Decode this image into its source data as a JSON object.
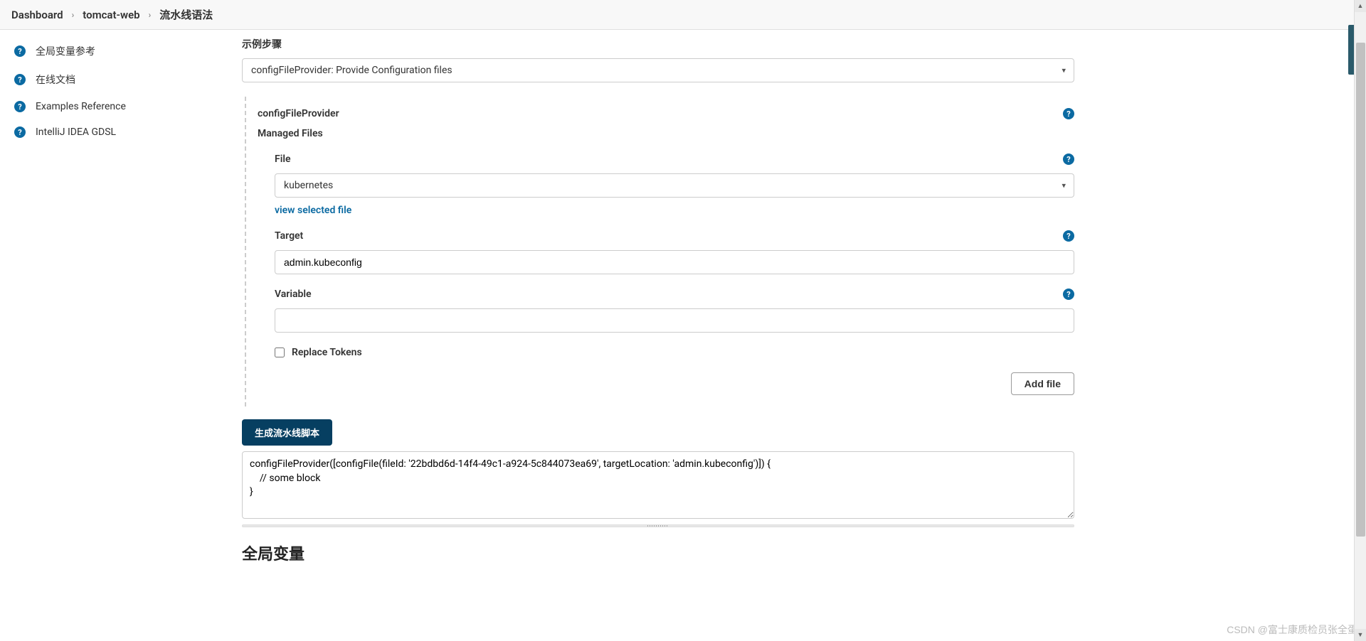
{
  "breadcrumb": {
    "items": [
      "Dashboard",
      "tomcat-web",
      "流水线语法"
    ]
  },
  "sidebar": {
    "items": [
      {
        "label": "全局变量参考"
      },
      {
        "label": "在线文档"
      },
      {
        "label": "Examples Reference"
      },
      {
        "label": "IntelliJ IDEA GDSL"
      }
    ]
  },
  "main": {
    "sample_step_label": "示例步骤",
    "step_select": "configFileProvider: Provide Configuration files",
    "provider_title": "configFileProvider",
    "managed_files_label": "Managed Files",
    "file_label": "File",
    "file_select": "kubernetes",
    "view_file_link": "view selected file",
    "target_label": "Target",
    "target_value": "admin.kubeconfig",
    "variable_label": "Variable",
    "variable_value": "",
    "replace_tokens_label": "Replace Tokens",
    "add_file_button": "Add file",
    "generate_button": "生成流水线脚本",
    "output_script": "configFileProvider([configFile(fileId: '22bdbd6d-14f4-49c1-a924-5c844073ea69', targetLocation: 'admin.kubeconfig')]) {\n    // some block\n}",
    "global_vars_title": "全局变量"
  },
  "watermark": "CSDN @富士康质检员张全蛋"
}
